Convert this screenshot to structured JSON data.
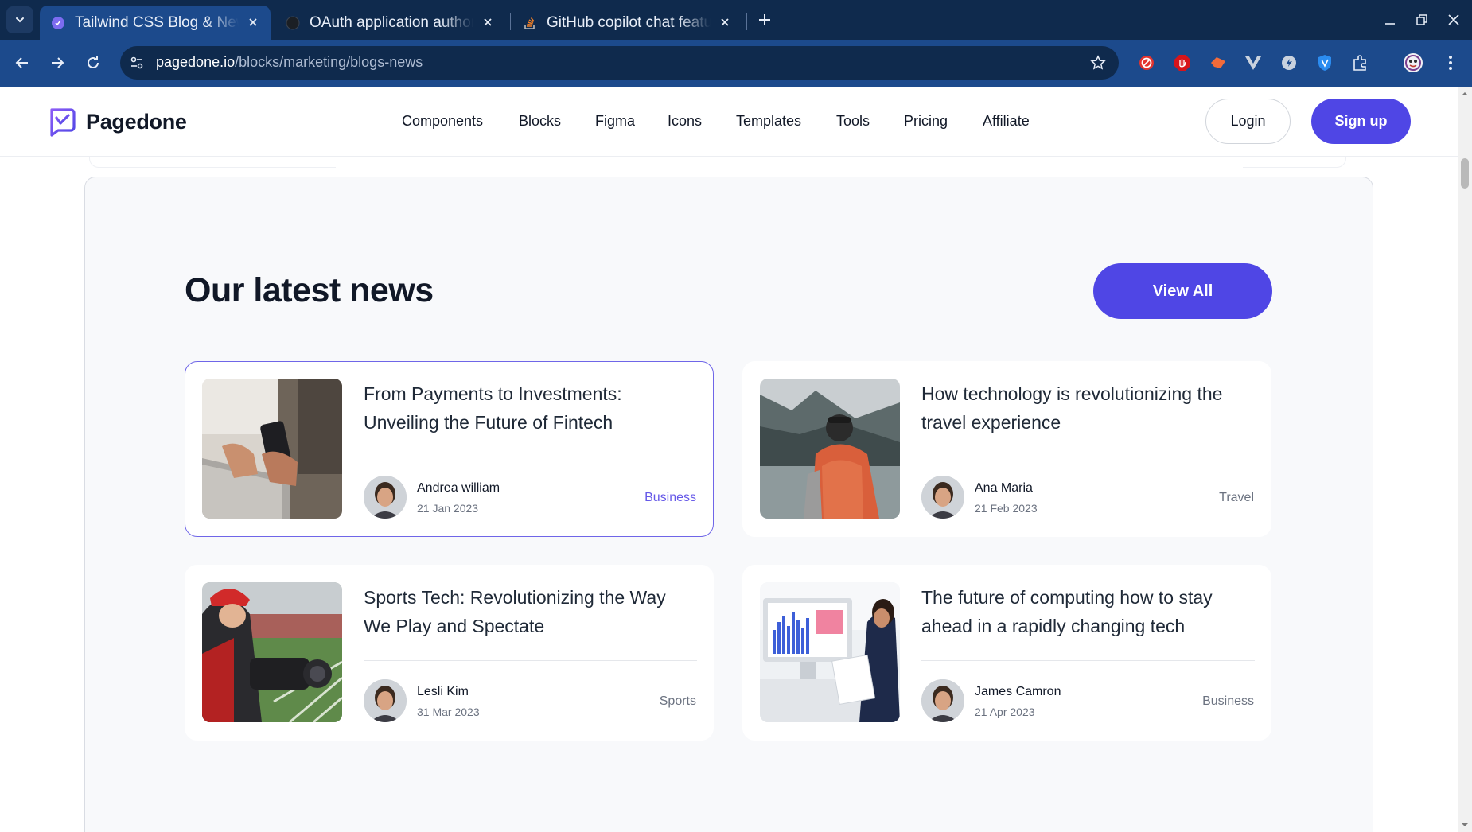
{
  "browser": {
    "tabs": [
      {
        "title": "Tailwind CSS Blog & News",
        "active": true
      },
      {
        "title": "OAuth application authorization",
        "active": false
      },
      {
        "title": "GitHub copilot chat features",
        "active": false
      }
    ],
    "url_host": "pagedone.io",
    "url_path": "/blocks/marketing/blogs-news",
    "colors": {
      "tabbar": "#0f2a4d",
      "toolbar": "#1c4a8c"
    }
  },
  "site": {
    "brand": "Pagedone",
    "nav": [
      "Components",
      "Blocks",
      "Figma",
      "Icons",
      "Templates",
      "Tools",
      "Pricing",
      "Affiliate"
    ],
    "login_label": "Login",
    "signup_label": "Sign up",
    "accent_color": "#4f46e5"
  },
  "news": {
    "heading": "Our latest news",
    "view_all_label": "View All",
    "cards": [
      {
        "title": "From Payments to Investments: Unveiling the Future of Fintech",
        "author": "Andrea william",
        "date": "21 Jan 2023",
        "category": "Business",
        "image": "phone-laptop-photo"
      },
      {
        "title": "How technology is revolutionizing the travel experience",
        "author": "Ana Maria",
        "date": "21 Feb 2023",
        "category": "Travel",
        "image": "hiker-lake-photo"
      },
      {
        "title": "Sports Tech: Revolutionizing the Way We Play and Spectate",
        "author": "Lesli Kim",
        "date": "31 Mar 2023",
        "category": "Sports",
        "image": "camera-operator-stadium-photo"
      },
      {
        "title": "The future of computing how to stay ahead in a rapidly changing tech",
        "author": "James Camron",
        "date": "21 Apr 2023",
        "category": "Business",
        "image": "analyst-monitor-photo"
      }
    ]
  }
}
